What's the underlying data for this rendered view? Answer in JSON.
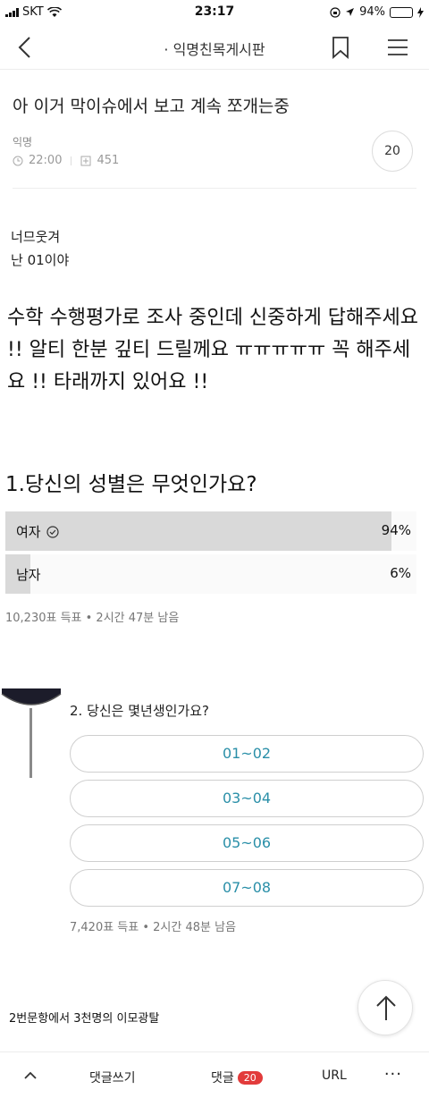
{
  "status_bar": {
    "carrier": "SKT",
    "time": "23:17",
    "battery": "94%",
    "battery_fill": 0.94
  },
  "nav": {
    "title": "· 익명친목게시판",
    "back_icon": "chevron-left-icon",
    "bookmark_icon": "bookmark-icon",
    "menu_icon": "menu-icon"
  },
  "post": {
    "title": "아 이거 막이슈에서 보고 계속 쪼개는중",
    "author": "익명",
    "time": "22:00",
    "views": "451",
    "comment_count": "20"
  },
  "body": {
    "line1": "너므웃겨",
    "line2": "난 01이야",
    "big_text": "수학 수행평가로 조사 중인데 신중하게 답해주세요 !! 알티 한분 깊티 드릴께요 ㅠㅠㅠㅠㅠ 꼭 해주세요 !! 타래까지 있어요 !!"
  },
  "poll1": {
    "question": "1.당신의 성별은 무엇인가요?",
    "options": [
      {
        "label": "여자",
        "percent": "94%",
        "value": 0.94,
        "selected": true
      },
      {
        "label": "남자",
        "percent": "6%",
        "value": 0.06,
        "selected": false
      }
    ],
    "meta": "10,230표 득표 • 2시간 47분 남음"
  },
  "poll2": {
    "question": "2. 당신은 몇년생인가요?",
    "options": [
      "01~02",
      "03~04",
      "05~06",
      "07~08"
    ],
    "meta": "7,420표 득표 • 2시간 48분 남음"
  },
  "footnote": "2번문항에서 3천명의 이모광탈",
  "bottom_bar": {
    "write": "댓글쓰기",
    "comment": "댓글",
    "comment_count": "20",
    "url": "URL",
    "more": "···"
  },
  "colors": {
    "poll_bar": "#d9d9d9",
    "pill_text": "#2a8fa8",
    "badge_red": "#e23b3b",
    "battery_green": "#3cc14a"
  }
}
